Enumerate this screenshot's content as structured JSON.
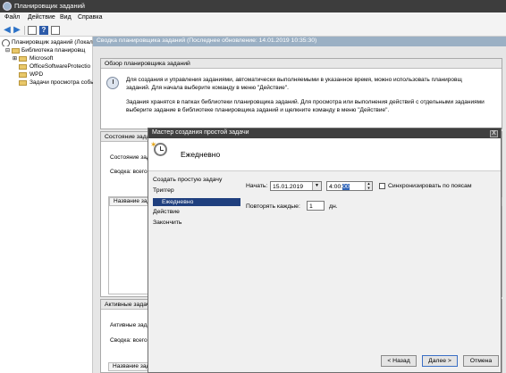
{
  "window": {
    "title": "Планировщик заданий"
  },
  "menu": {
    "file": "Файл",
    "action": "Действие",
    "view": "Вид",
    "help": "Справка"
  },
  "tree": {
    "root": "Планировщик заданий (Локал",
    "library": "Библиотека планировщ",
    "items": [
      "Microsoft",
      "OfficeSoftwareProtectio",
      "WPD",
      "Задачи просмотра собы"
    ]
  },
  "main": {
    "header": "Сводка планировщика заданий (Последнее обновление: 14.01.2019 10:35:30)",
    "overview": {
      "title": "Обзор планировщика заданий",
      "text1_line1": "Для создания и управления заданиями, автоматически выполняемыми в указанное время, можно использовать планировщ",
      "text1_line2": "заданий. Для начала выберите команду в меню \"Действие\".",
      "text2_line1": "Задания хранятся в папках библиотеки планировщика заданий. Для просмотра или выполнения действий с отдельными заданиями",
      "text2_line2": "выберите задание в библиотеке планировщика заданий и щелкните команду в меню \"Действие\"."
    },
    "status_panel": {
      "title": "Состояние задач",
      "line1": "Состояние зад",
      "line2": "Сводка: всего",
      "column": "Название зад"
    },
    "active_panel": {
      "title": "Активные задачи",
      "line1": "Активные зада",
      "line2": "Сводка: всего",
      "column": "Название зад"
    }
  },
  "dialog": {
    "title": "Мастер создания простой задачи",
    "close": "X",
    "heading": "Ежедневно",
    "steps": [
      "Создать простую задачу",
      "Триггер",
      "Ежедневно",
      "Действие",
      "Закончить"
    ],
    "selected_step": "Ежедневно",
    "start_label": "Начать:",
    "start_date": "15.01.2019",
    "start_time_prefix": "4:00:",
    "start_time_selected": "00",
    "sync_label": "Синхронизировать по поясам",
    "repeat_label": "Повторять каждые:",
    "repeat_value": "1",
    "repeat_unit": "дн.",
    "buttons": {
      "back": "< Назад",
      "next": "Далее >",
      "cancel": "Отмена"
    }
  }
}
